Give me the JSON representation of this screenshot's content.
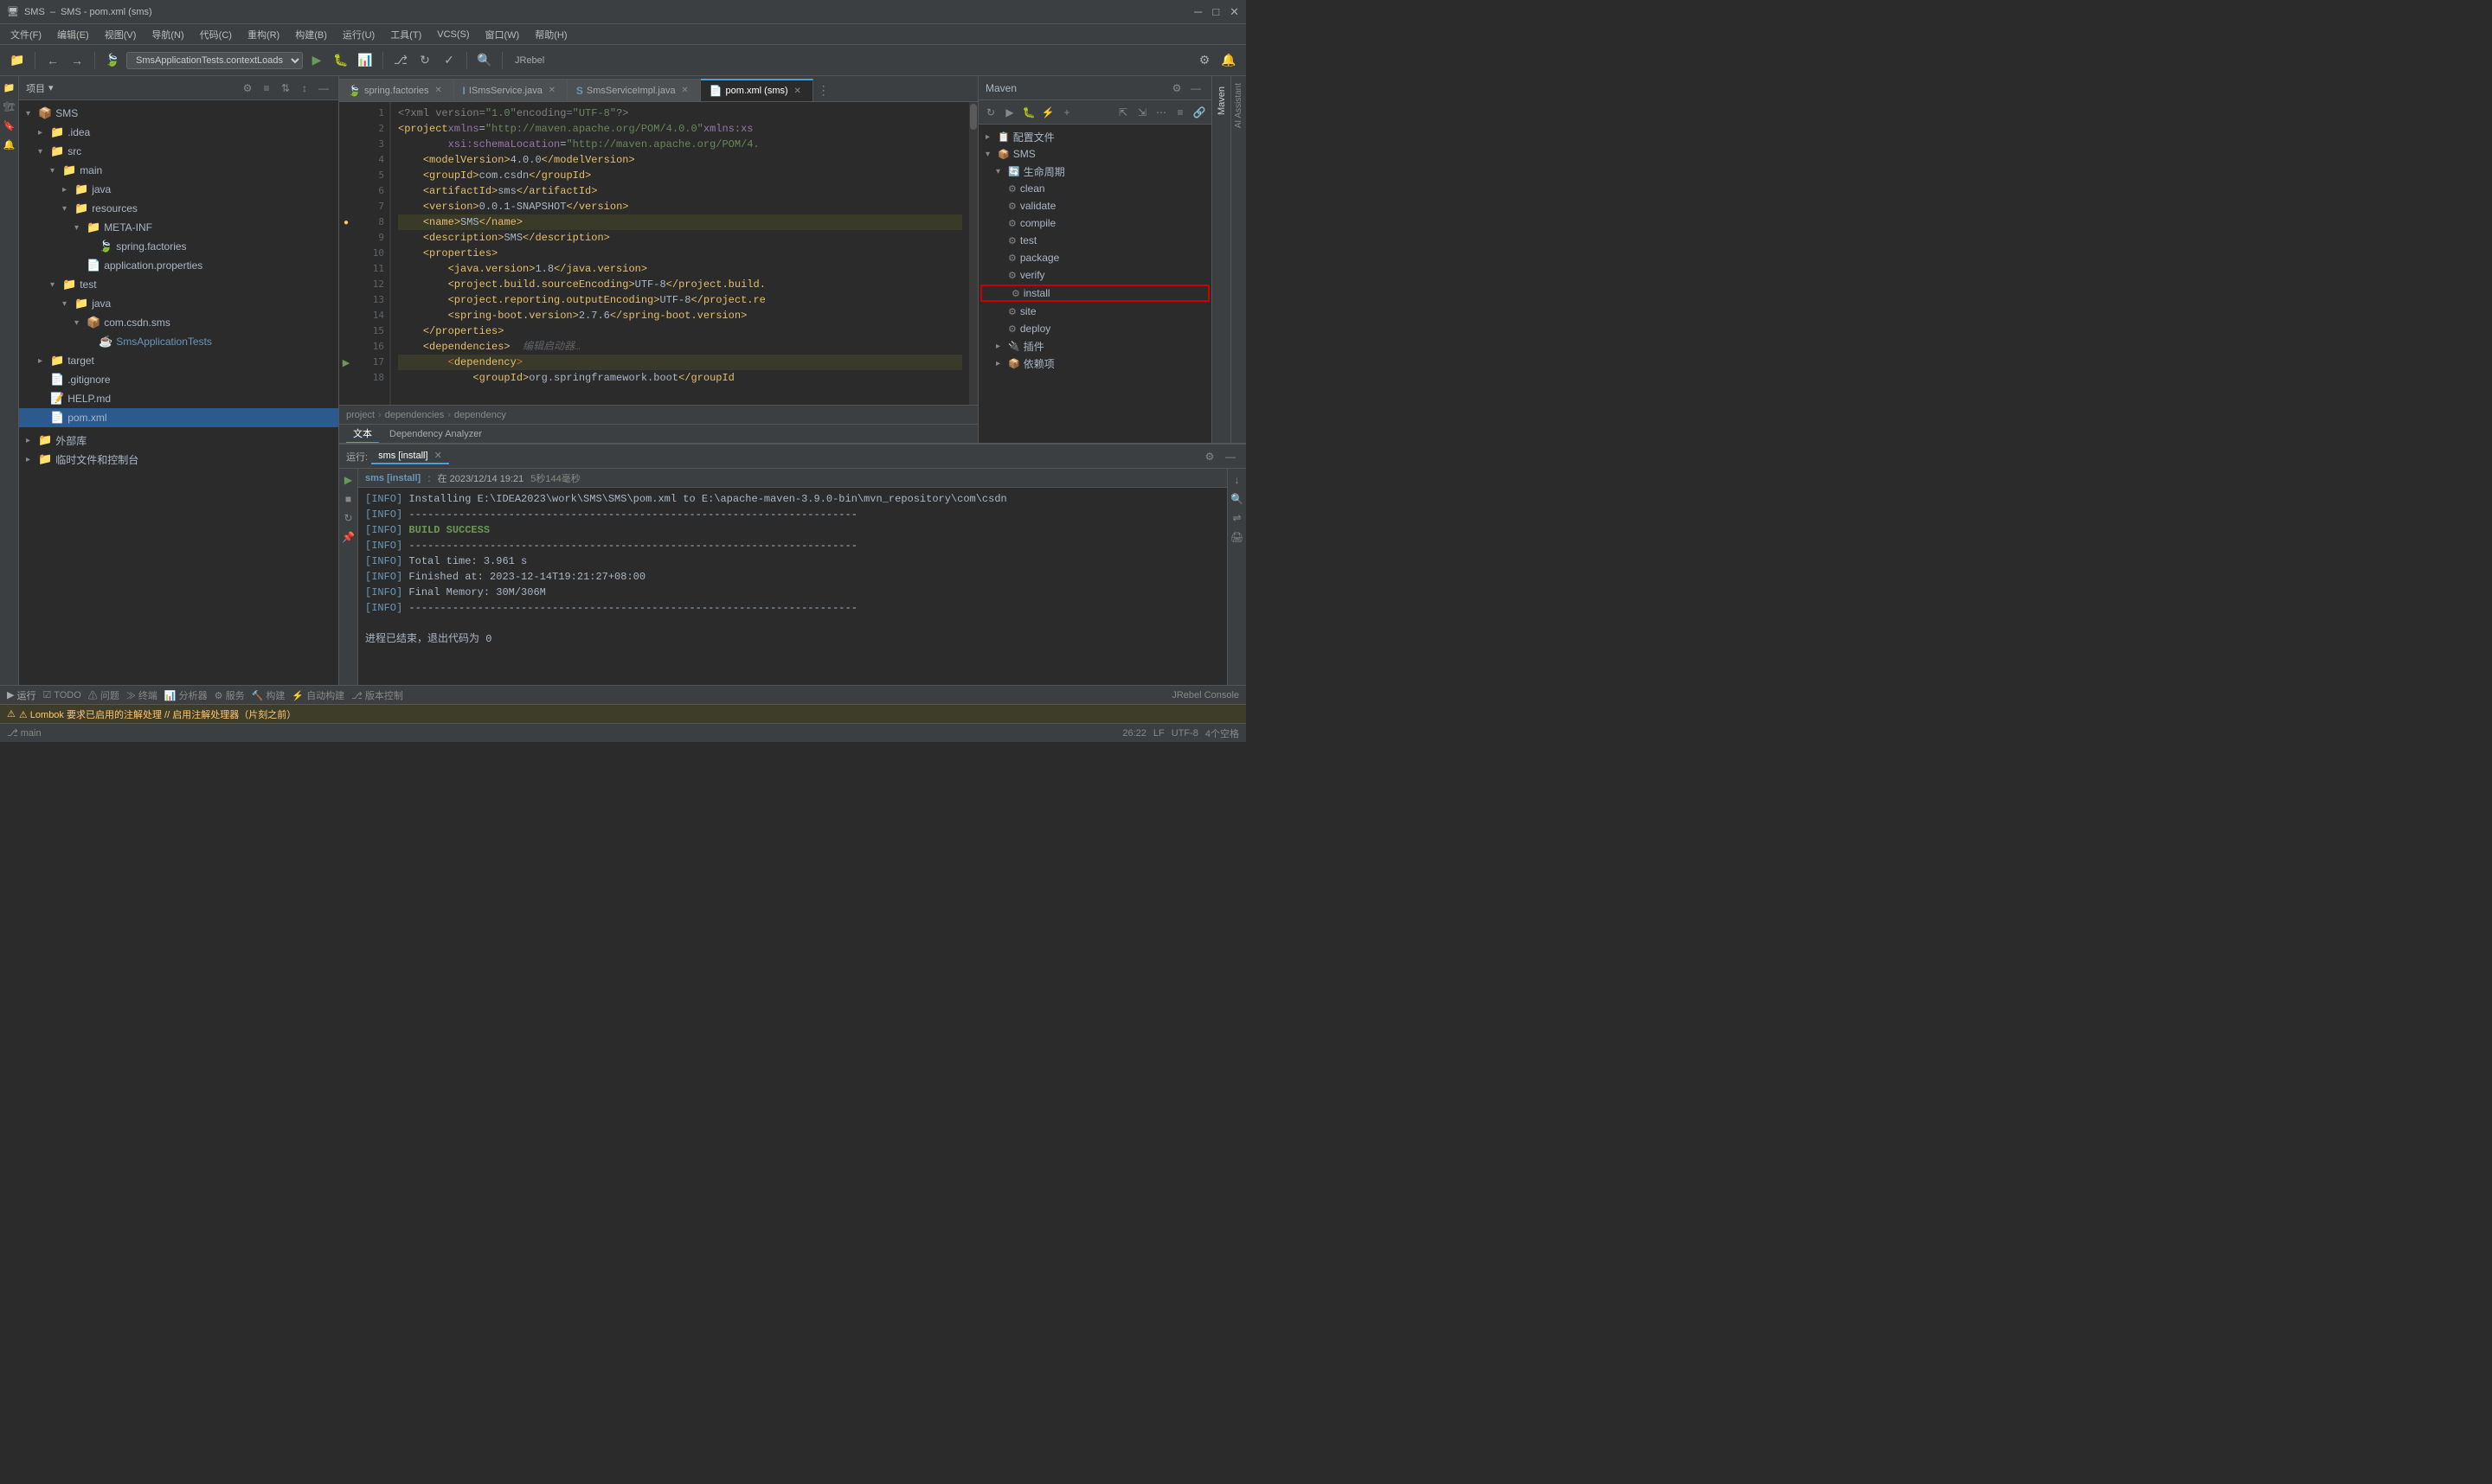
{
  "window": {
    "title": "SMS - pom.xml (sms)",
    "app_title": "SMS",
    "file_name": "pom.xml"
  },
  "menubar": {
    "items": [
      "文件(F)",
      "编辑(E)",
      "视图(V)",
      "导航(N)",
      "代码(C)",
      "重构(R)",
      "构建(B)",
      "运行(U)",
      "工具(T)",
      "VCS(S)",
      "窗口(W)",
      "帮助(H)"
    ]
  },
  "toolbar": {
    "run_config": "SmsApplicationTests.contextLoads",
    "jrebel_label": "JRebel"
  },
  "project_panel": {
    "title": "项目",
    "root": "SMS",
    "tree": [
      {
        "label": "SMS",
        "level": 0,
        "icon": "📁",
        "expanded": true
      },
      {
        "label": ".idea",
        "level": 1,
        "icon": "📁"
      },
      {
        "label": "src",
        "level": 1,
        "icon": "📁",
        "expanded": true
      },
      {
        "label": "main",
        "level": 2,
        "icon": "📁",
        "expanded": true
      },
      {
        "label": "java",
        "level": 3,
        "icon": "📁",
        "expanded": false
      },
      {
        "label": "resources",
        "level": 3,
        "icon": "📁",
        "expanded": true
      },
      {
        "label": "META-INF",
        "level": 4,
        "icon": "📁",
        "expanded": true
      },
      {
        "label": "spring.factories",
        "level": 5,
        "icon": "📄",
        "color": "normal"
      },
      {
        "label": "application.properties",
        "level": 4,
        "icon": "📄"
      },
      {
        "label": "test",
        "level": 2,
        "icon": "📁",
        "expanded": true
      },
      {
        "label": "java",
        "level": 3,
        "icon": "📁",
        "expanded": true
      },
      {
        "label": "com.csdn.sms",
        "level": 4,
        "icon": "📦"
      },
      {
        "label": "SmsApplicationTests",
        "level": 5,
        "icon": "☕",
        "color": "blue"
      },
      {
        "label": "target",
        "level": 1,
        "icon": "📁"
      },
      {
        "label": ".gitignore",
        "level": 1,
        "icon": "📄"
      },
      {
        "label": "HELP.md",
        "level": 1,
        "icon": "📄"
      },
      {
        "label": "pom.xml",
        "level": 1,
        "icon": "📄",
        "color": "normal",
        "selected": true
      }
    ]
  },
  "project_panel_bottom": [
    {
      "label": "外部库"
    },
    {
      "label": "临时文件和控制台"
    }
  ],
  "editor": {
    "tabs": [
      {
        "label": "spring.factories",
        "icon": "🍃",
        "active": false,
        "modified": false
      },
      {
        "label": "ISmsService.java",
        "icon": "I",
        "active": false,
        "modified": false
      },
      {
        "label": "SmsServiceImpl.java",
        "icon": "S",
        "active": false,
        "modified": false
      },
      {
        "label": "pom.xml (sms)",
        "icon": "📄",
        "active": true,
        "modified": false
      }
    ],
    "lines": [
      {
        "num": 1,
        "content": "<?xml version=\"1.0\" encoding=\"UTF-8\"?>",
        "indent": 0
      },
      {
        "num": 2,
        "content": "<project xmlns=\"http://maven.apache.org/POM/4.0.0\" xmlns:xs",
        "indent": 0
      },
      {
        "num": 3,
        "content": "         xsi:schemaLocation=\"http://maven.apache.org/POM/4.",
        "indent": 0
      },
      {
        "num": 4,
        "content": "    <modelVersion>4.0.0</modelVersion>",
        "indent": 1
      },
      {
        "num": 5,
        "content": "    <groupId>com.csdn</groupId>",
        "indent": 1
      },
      {
        "num": 6,
        "content": "    <artifactId>sms</artifactId>",
        "indent": 1
      },
      {
        "num": 7,
        "content": "    <version>0.0.1-SNAPSHOT</version>",
        "indent": 1
      },
      {
        "num": 8,
        "content": "    <name>SMS</name>",
        "indent": 1
      },
      {
        "num": 9,
        "content": "    <description>SMS</description>",
        "indent": 1
      },
      {
        "num": 10,
        "content": "    <properties>",
        "indent": 1
      },
      {
        "num": 11,
        "content": "        <java.version>1.8</java.version>",
        "indent": 2
      },
      {
        "num": 12,
        "content": "        <project.build.sourceEncoding>UTF-8</project.build.",
        "indent": 2
      },
      {
        "num": 13,
        "content": "        <project.reporting.outputEncoding>UTF-8</project.re",
        "indent": 2
      },
      {
        "num": 14,
        "content": "        <spring-boot.version>2.7.6</spring-boot.version>",
        "indent": 2
      },
      {
        "num": 15,
        "content": "    </properties>",
        "indent": 1
      },
      {
        "num": 16,
        "content": "    <dependencies>  编辑启动器…",
        "indent": 1,
        "has_hint": true
      },
      {
        "num": 17,
        "content": "        <dependency>",
        "indent": 2,
        "has_bookmark": true
      },
      {
        "num": 18,
        "content": "            <groupId>org.springframework.boot</groupId>",
        "indent": 3
      }
    ],
    "breadcrumb": [
      "project",
      "dependencies",
      "dependency"
    ]
  },
  "bottom_tabs": [
    {
      "label": "文本",
      "active": true
    },
    {
      "label": "Dependency Analyzer",
      "active": false
    }
  ],
  "maven": {
    "title": "Maven",
    "sections": [
      {
        "label": "配置文件",
        "expanded": false
      },
      {
        "label": "SMS",
        "expanded": true
      },
      {
        "label": "生命周期",
        "expanded": true
      },
      {
        "children": [
          {
            "label": "clean",
            "icon": "⚙"
          },
          {
            "label": "validate",
            "icon": "⚙"
          },
          {
            "label": "compile",
            "icon": "⚙"
          },
          {
            "label": "test",
            "icon": "⚙"
          },
          {
            "label": "package",
            "icon": "⚙"
          },
          {
            "label": "verify",
            "icon": "⚙"
          },
          {
            "label": "install",
            "icon": "⚙",
            "selected": true
          },
          {
            "label": "site",
            "icon": "⚙"
          },
          {
            "label": "deploy",
            "icon": "⚙"
          }
        ]
      },
      {
        "label": "插件",
        "expanded": false
      },
      {
        "label": "依赖项",
        "expanded": false
      }
    ]
  },
  "terminal": {
    "run_label": "运行:",
    "run_name": "sms [install]",
    "run_status": "在 2023/12/14 19:21",
    "run_time": "5秒144毫秒",
    "logs": [
      {
        "text": "[INFO] Installing E:\\IDEA2023\\work\\SMS\\SMS\\pom.xml to E:\\apache-maven-3.9.0-bin\\mvn_repository\\com\\csdn",
        "type": "info"
      },
      {
        "text": "[INFO] ------------------------------------------------------------------------",
        "type": "info"
      },
      {
        "text": "[INFO] BUILD SUCCESS",
        "type": "success"
      },
      {
        "text": "[INFO] ------------------------------------------------------------------------",
        "type": "info"
      },
      {
        "text": "[INFO] Total time:  3.961 s",
        "type": "info"
      },
      {
        "text": "[INFO] Finished at: 2023-12-14T19:21:27+08:00",
        "type": "info"
      },
      {
        "text": "[INFO] Final Memory: 30M/306M",
        "type": "info"
      },
      {
        "text": "[INFO] ------------------------------------------------------------------------",
        "type": "info"
      },
      {
        "text": "",
        "type": "empty"
      },
      {
        "text": "进程已结束，退出代码为 0",
        "type": "end"
      }
    ]
  },
  "status_bar": {
    "left": "运行:",
    "warning": "⚠ Lombok 要求已启用的注解处理 // 启用注解处理器（片刻之前）",
    "line_col": "26:22",
    "encoding": "UTF-8",
    "line_sep": "LF",
    "spaces": "4个空格",
    "jrebel_console": "JRebel Console"
  }
}
